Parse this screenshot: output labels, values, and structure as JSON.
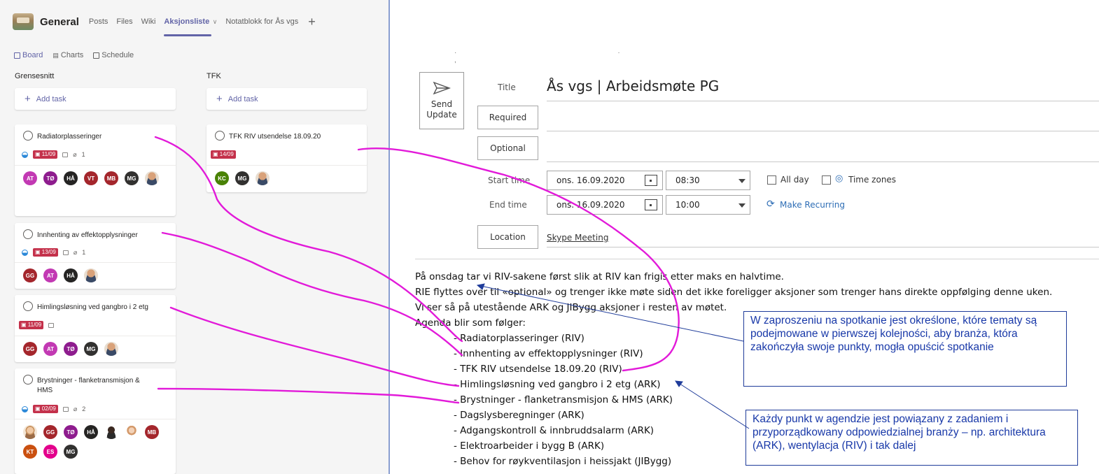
{
  "planner": {
    "team_name": "General",
    "tabs": [
      {
        "label": "Posts"
      },
      {
        "label": "Files"
      },
      {
        "label": "Wiki"
      },
      {
        "label": "Aksjonsliste"
      },
      {
        "label": "Notatblokk for Ås vgs"
      }
    ],
    "views": [
      "Board",
      "Charts",
      "Schedule"
    ],
    "columns": [
      {
        "title": "Grensesnitt",
        "add_task": "Add task",
        "cards": [
          {
            "title": "Radiatorplasseringer",
            "date": "11/09",
            "attachments": "1",
            "progress": "in progress",
            "avatars": [
              "AT",
              "TØ",
              "HÅ",
              "VT",
              "MB",
              "MG",
              "photo"
            ]
          },
          {
            "title": "Innhenting av effektopplysninger",
            "date": "13/09",
            "attachments": "1",
            "progress": "in progress",
            "avatars": [
              "GG",
              "AT",
              "HÅ",
              "photo"
            ]
          },
          {
            "title": "Himlingsløsning ved gangbro i 2 etg",
            "date": "11/09",
            "attachments": "",
            "progress": "not started",
            "avatars": [
              "GG",
              "AT",
              "TØ",
              "MG",
              "photo"
            ]
          },
          {
            "title": "Brystninger - flanketransmisjon & HMS",
            "date": "02/09",
            "attachments": "2",
            "progress": "in progress",
            "avatars": [
              "photo-light",
              "GG",
              "TØ",
              "HÅ",
              "silhouette",
              "silhouette-light",
              "MB",
              "KT",
              "ES",
              "MG"
            ]
          }
        ]
      },
      {
        "title": "TFK",
        "add_task": "Add task",
        "cards": [
          {
            "title": "TFK RIV utsendelse 18.09.20",
            "date": "14/09",
            "attachments": "",
            "progress": "not started",
            "avatars": [
              "KC",
              "MG",
              "photo"
            ]
          }
        ]
      }
    ],
    "avatar_colors": {
      "AT": "#c239b3",
      "TØ": "#8e1c8e",
      "HÅ": "#252423",
      "VT": "#a4262c",
      "MB": "#a4262c",
      "MG": "#323130",
      "GG": "#a4262c",
      "KC": "#498205",
      "KT": "#ca5010",
      "ES": "#e3008c"
    }
  },
  "meeting": {
    "send_update_label": [
      "Send",
      "Update"
    ],
    "title_label": "Title",
    "title_value": "Ås vgs | Arbeidsmøte PG",
    "required_label": "Required",
    "optional_label": "Optional",
    "start_label": "Start time",
    "end_label": "End time",
    "start_date": "ons. 16.09.2020",
    "start_time": "08:30",
    "end_date": "ons. 16.09.2020",
    "end_time": "10:00",
    "all_day_label": "All day",
    "time_zones_label": "Time zones",
    "make_recurring_label": "Make Recurring",
    "location_label": "Location",
    "location_value": "Skype Meeting",
    "body_lines": [
      "På onsdag tar vi RIV-sakene først slik at RIV kan frigis etter maks en halvtime.",
      "RIE flyttes over til «optional» og trenger ikke møte siden det ikke foreligger aksjoner som trenger hans direkte oppfølging denne uken.",
      "Vi ser så på utestående ARK og JIBygg aksjoner i resten av møtet.",
      "Agenda blir som følger:"
    ],
    "agenda": [
      "- Radiatorplasseringer (RIV)",
      "- Innhenting av effektopplysninger (RIV)",
      "- TFK RIV utsendelse 18.09.20 (RIV)",
      "- Himlingsløsning ved gangbro i 2 etg (ARK)",
      "- Brystninger - flanketransmisjon & HMS (ARK)",
      "- Dagslysberegninger (ARK)",
      "- Adgangskontroll & innbruddsalarm (ARK)",
      "- Elektroarbeider i bygg B (ARK)",
      "- Behov for røykventilasjon i heissjakt (JIBygg)"
    ]
  },
  "annotations": {
    "callout_1": "W zaproszeniu na spotkanie jest określone, które tematy są podejmowane w pierwszej kolejności, aby branża, która zakończyła swoje punkty, mogła opuścić spotkanie",
    "callout_2": "Każdy punkt w agendzie jest powiązany z zadaniem i przyporządkowany odpowiedzialnej branży – np. architektura (ARK), wentylacja (RIV) i tak dalej",
    "connector_color": "#e21ad9",
    "callout_color": "#1f3c9a"
  }
}
